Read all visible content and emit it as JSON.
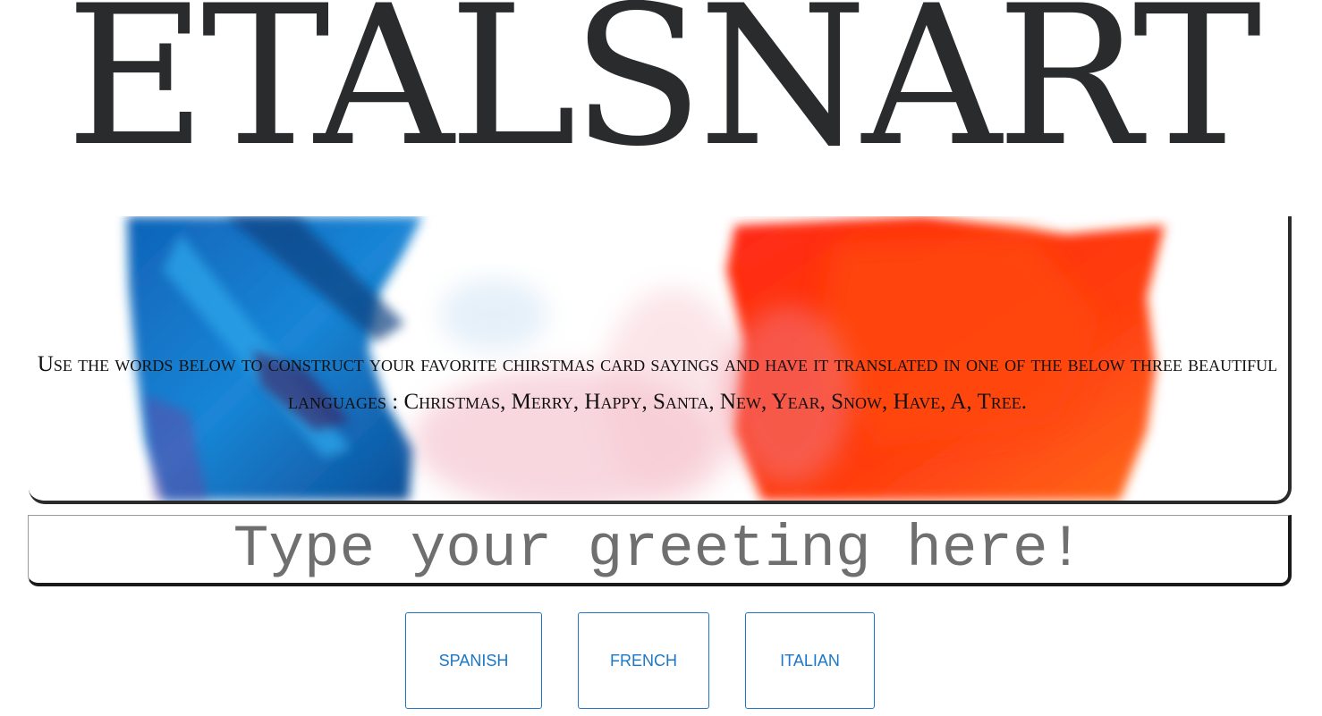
{
  "header": {
    "title": "ETALSNART"
  },
  "banner": {
    "instructions": "Use the words below to construct your favorite chirstmas card sayings and have it translated in one of the below three beautiful languages : Christmas, Merry, Happy, Santa, New, Year, Snow, Have, A, Tree."
  },
  "greeting": {
    "placeholder": "Type your greeting here!",
    "value": ""
  },
  "languages": {
    "spanish_label": "SPANISH",
    "french_label": "FRENCH",
    "italian_label": "ITALIAN"
  },
  "colors": {
    "title": "#292b2c",
    "button_accent": "#1b77c7",
    "paint_blue": "#1670c8",
    "paint_red": "#ff3a14"
  }
}
